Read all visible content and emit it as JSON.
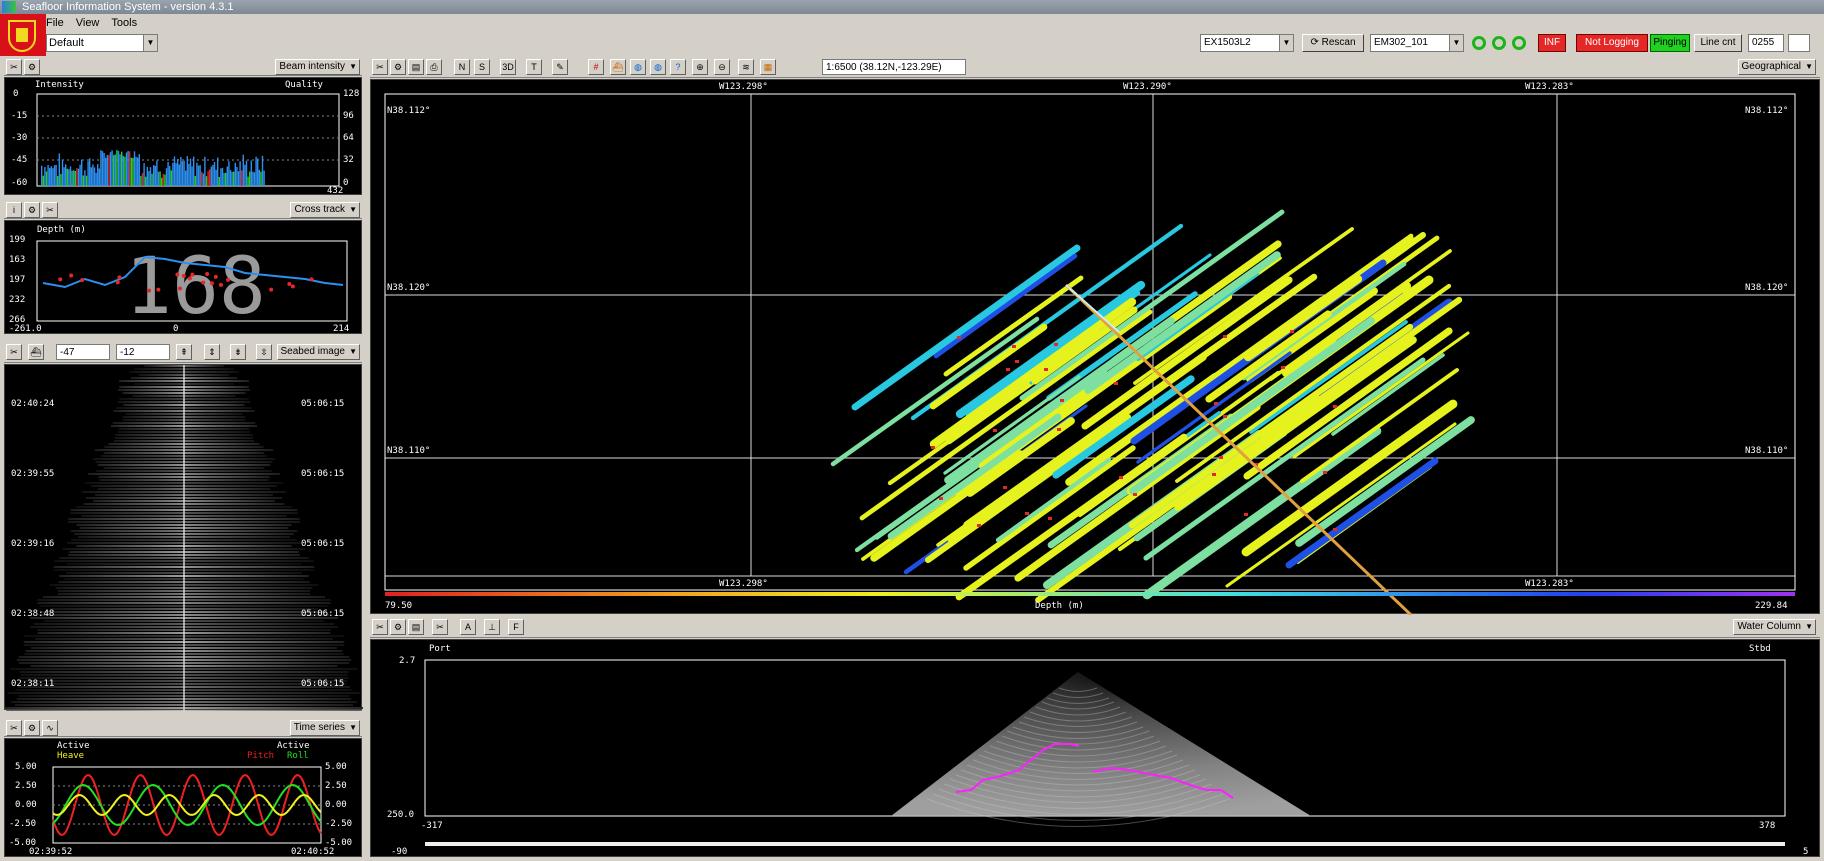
{
  "window": {
    "title": "Seafloor Information System - version 4.3.1"
  },
  "menu": [
    "File",
    "View",
    "Tools"
  ],
  "profile": {
    "value": "Default"
  },
  "toolbar": {
    "sounder": "EX1503L2",
    "rescan": "Rescan",
    "survey": "EM302_101",
    "inf": "INF",
    "not_logging": "Not Logging",
    "pinging": "Pinging",
    "line_cnt": "Line cnt",
    "line_value": "0255"
  },
  "beam_panel": {
    "dropdown": "Beam intensity",
    "left_title": "Intensity",
    "right_title": "Quality",
    "y_left": [
      "0",
      "-15",
      "-30",
      "-45",
      "-60"
    ],
    "y_right": [
      "128",
      "96",
      "64",
      "32",
      "0"
    ],
    "x_right": "432"
  },
  "cross_panel": {
    "dropdown": "Cross track",
    "title": "Depth (m)",
    "big_value": "168",
    "y_labels": [
      "199",
      "163",
      "197",
      "232",
      "266"
    ],
    "x_labels": [
      "-261.0",
      "0",
      "214"
    ]
  },
  "seabed_panel": {
    "dropdown": "Seabed image",
    "spin1": "-47",
    "spin2": "-12",
    "left_times": [
      "02:40:24",
      "02:39:55",
      "02:39:16",
      "02:38:48",
      "02:38:11"
    ],
    "right_times": [
      "05:06:15",
      "05:06:15",
      "05:06:15",
      "05:06:15",
      "05:06:15"
    ]
  },
  "time_panel": {
    "dropdown": "Time series",
    "left_active": "Active",
    "right_active": "Active",
    "heave": "Heave",
    "pitch": "Pitch",
    "roll": "Roll",
    "y_left": [
      "5.00",
      "2.50",
      "0.00",
      "-2.50",
      "-5.00"
    ],
    "y_right": [
      "5.00",
      "2.50",
      "0.00",
      "-2.50",
      "-5.00"
    ],
    "x_left": "02:39:52",
    "x_right": "02:40:52"
  },
  "map_panel": {
    "scale": "1:6500 (38.12N,-123.29E)",
    "projection": "Geographical",
    "top_lons": [
      "W123.298°",
      "W123.290°",
      "W123.283°"
    ],
    "bottom_lons": [
      "W123.298°",
      "W123.283°"
    ],
    "lats": [
      "N38.112°",
      "N38.120°",
      "N38.110°"
    ],
    "color_min": "79.50",
    "color_max": "229.84",
    "color_label": "Depth (m)",
    "mode_buttons": [
      "N",
      "S",
      "3D",
      "T"
    ]
  },
  "wc_panel": {
    "dropdown": "Water Column",
    "port": "Port",
    "stbd": "Stbd",
    "y_top": "2.7",
    "y_bottom": "250.0",
    "x_left": "-317",
    "x_right": "378",
    "slider_left": "-90",
    "slider_right": "5"
  },
  "colors": {
    "depth_yellow": "#e6f21e",
    "depth_cyan": "#28c8e0",
    "depth_blue": "#1e50e6",
    "ping_red": "#e42828",
    "ping_green": "#22d022",
    "bottom_magenta": "#ff20ff"
  }
}
